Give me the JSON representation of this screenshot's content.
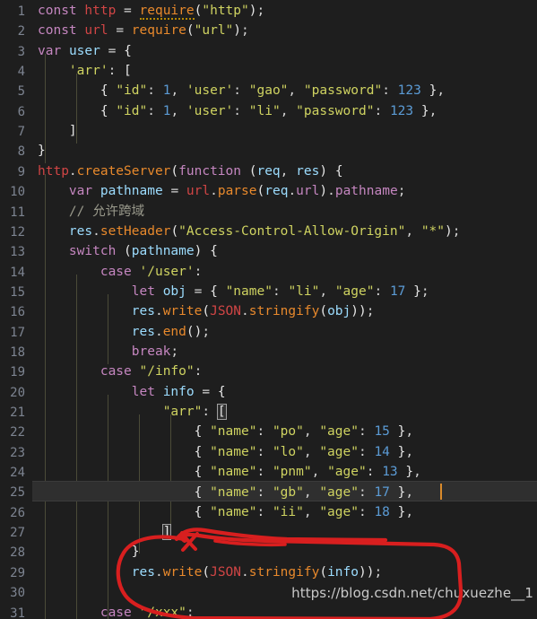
{
  "editor": {
    "language": "javascript",
    "theme": "dark",
    "background_color": "#1e1e1e",
    "gutter_color": "#1e1e1e",
    "line_number_color": "#7d8491",
    "current_line": 25,
    "current_line_highlight_color": "#2f2f2f",
    "cursor_color": "#d98a2b",
    "indent_guide_color": "#5b5b42",
    "first_visible_line": 1,
    "last_visible_line": 31
  },
  "annotation": {
    "color": "#d81f1f",
    "shape": "hand-drawn-ellipse",
    "encircles_lines": "27-30"
  },
  "watermark": {
    "text": "https://blog.csdn.net/chuxuezhe__1",
    "color": "#d8d8d8"
  },
  "lines": [
    {
      "n": "1",
      "text": "const http = require(\"http\");"
    },
    {
      "n": "2",
      "text": "const url = require(\"url\");"
    },
    {
      "n": "3",
      "text": "var user = {"
    },
    {
      "n": "4",
      "text": "    'arr': ["
    },
    {
      "n": "5",
      "text": "        { \"id\": 1, 'user': \"gao\", \"password\": 123 },"
    },
    {
      "n": "6",
      "text": "        { \"id\": 1, 'user': \"li\", \"password\": 123 },"
    },
    {
      "n": "7",
      "text": "    ]"
    },
    {
      "n": "8",
      "text": "}"
    },
    {
      "n": "9",
      "text": "http.createServer(function (req, res) {"
    },
    {
      "n": "10",
      "text": "    var pathname = url.parse(req.url).pathname;"
    },
    {
      "n": "11",
      "text": "    // 允许跨域"
    },
    {
      "n": "12",
      "text": "    res.setHeader(\"Access-Control-Allow-Origin\", \"*\");"
    },
    {
      "n": "13",
      "text": "    switch (pathname) {"
    },
    {
      "n": "14",
      "text": "        case '/user':"
    },
    {
      "n": "15",
      "text": "            let obj = { \"name\": \"li\", \"age\": 17 };"
    },
    {
      "n": "16",
      "text": "            res.write(JSON.stringify(obj));"
    },
    {
      "n": "17",
      "text": "            res.end();"
    },
    {
      "n": "18",
      "text": "            break;"
    },
    {
      "n": "19",
      "text": "        case \"/info\":"
    },
    {
      "n": "20",
      "text": "            let info = {"
    },
    {
      "n": "21",
      "text": "                \"arr\": ["
    },
    {
      "n": "22",
      "text": "                    { \"name\": \"po\", \"age\": 15 },"
    },
    {
      "n": "23",
      "text": "                    { \"name\": \"lo\", \"age\": 14 },"
    },
    {
      "n": "24",
      "text": "                    { \"name\": \"pnm\", \"age\": 13 },"
    },
    {
      "n": "25",
      "text": "                    { \"name\": \"gb\", \"age\": 17 },"
    },
    {
      "n": "26",
      "text": "                    { \"name\": \"ii\", \"age\": 18 },"
    },
    {
      "n": "27",
      "text": "                ]"
    },
    {
      "n": "28",
      "text": "            }"
    },
    {
      "n": "29",
      "text": "            res.write(JSON.stringify(info));"
    },
    {
      "n": "30",
      "text": ""
    },
    {
      "n": "31",
      "text": "        case \"/xxx\":"
    }
  ]
}
